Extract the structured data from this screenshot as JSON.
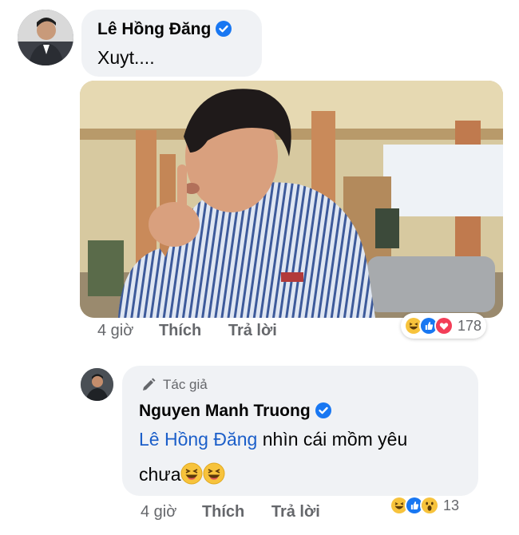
{
  "comment1": {
    "author": "Lê Hồng Đăng",
    "text": "Xuyt....",
    "time": "4 giờ",
    "like_label": "Thích",
    "reply_label": "Trả lời",
    "reactions": [
      "haha-icon",
      "like-icon",
      "love-icon"
    ],
    "reaction_count": "178"
  },
  "comment2": {
    "author_badge": "Tác giả",
    "author": "Nguyen Manh Truong",
    "mention": "Lê Hồng Đăng",
    "text_after_mention": " nhìn cái mồm yêu",
    "text_line2": "chưa",
    "inline_emojis": [
      "laughing-emoji",
      "laughing-emoji"
    ],
    "time": "4 giờ",
    "like_label": "Thích",
    "reply_label": "Trả lời",
    "reactions": [
      "haha-icon",
      "like-icon",
      "wow-icon"
    ],
    "reaction_count": "13"
  },
  "colors": {
    "bubble": "#f0f2f5",
    "mention": "#1c5fc9",
    "verified": "#1877f2",
    "meta_text": "#65676b"
  }
}
